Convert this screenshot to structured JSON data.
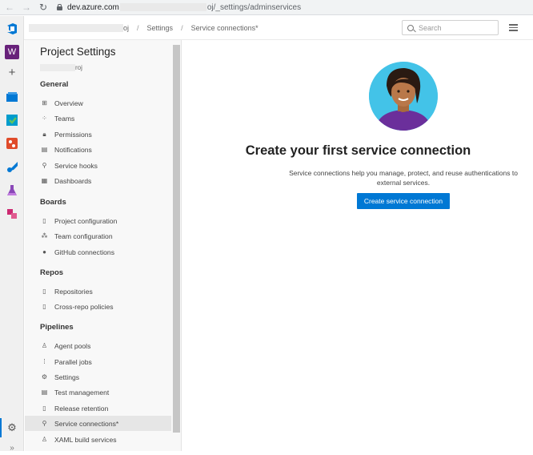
{
  "browser": {
    "url_host": "dev.azure.com",
    "url_path": "oj/_settings/adminservices"
  },
  "header": {
    "breadcrumb_project_suffix": "oj",
    "breadcrumb_settings": "Settings",
    "breadcrumb_current": "Service connections*",
    "search_placeholder": "Search"
  },
  "rail": {
    "org_initial": "W"
  },
  "panel": {
    "title": "Project Settings",
    "project_suffix": "roj",
    "sections": {
      "general": "General",
      "boards": "Boards",
      "repos": "Repos",
      "pipelines": "Pipelines"
    },
    "items": {
      "overview": "Overview",
      "teams": "Teams",
      "permissions": "Permissions",
      "notifications": "Notifications",
      "service_hooks": "Service hooks",
      "dashboards": "Dashboards",
      "project_configuration": "Project configuration",
      "team_configuration": "Team configuration",
      "github_connections": "GitHub connections",
      "repositories": "Repositories",
      "cross_repo_policies": "Cross-repo policies",
      "agent_pools": "Agent pools",
      "parallel_jobs": "Parallel jobs",
      "settings": "Settings",
      "test_management": "Test management",
      "release_retention": "Release retention",
      "service_connections": "Service connections*",
      "xaml_build_services": "XAML build services"
    }
  },
  "main": {
    "title": "Create your first service connection",
    "description": "Service connections help you manage, protect, and reuse authentications to external services.",
    "button_label": "Create service connection"
  },
  "colors": {
    "accent": "#0078d4",
    "avatar_bg": "#43c3e8",
    "shirt": "#6b2f9b"
  }
}
